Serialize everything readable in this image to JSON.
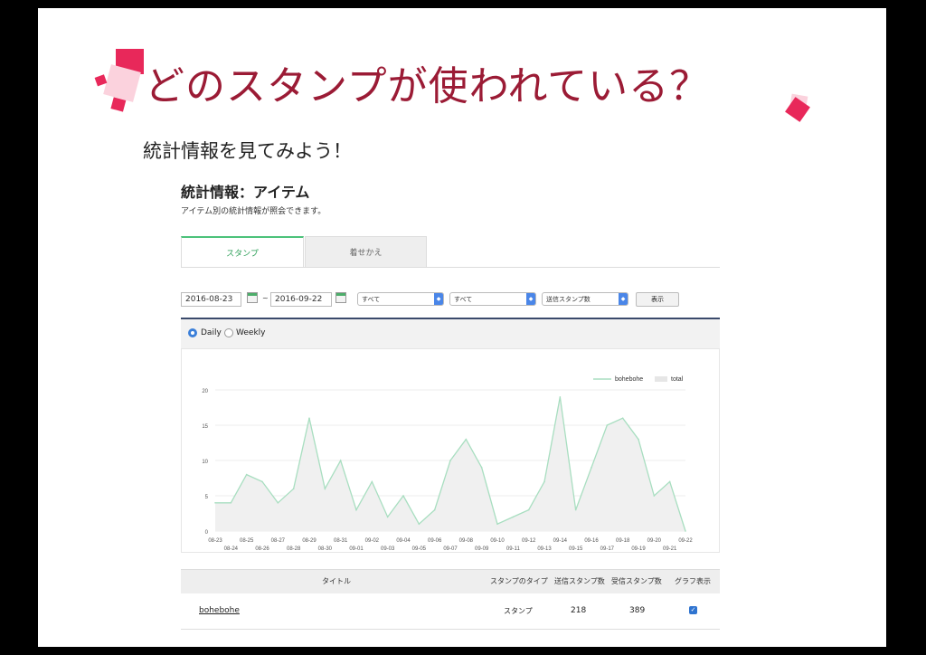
{
  "slide": {
    "title": "どのスタンプが使われている？",
    "subtitle": "統計情報を見てみよう！",
    "accent_color": "#e8285a",
    "title_color": "#9b1b35"
  },
  "screen": {
    "page_title": "統計情報：アイテム",
    "page_desc": "アイテム別の統計情報が照会できます。",
    "tabs": [
      {
        "label": "スタンプ",
        "active": true
      },
      {
        "label": "着せかえ",
        "active": false
      }
    ],
    "filters": {
      "start_date": "2016-08-23",
      "separator": "~",
      "end_date": "2016-09-22",
      "select1": "すべて",
      "select2": "すべて",
      "select3": "送信スタンプ数",
      "show_label": "表示"
    },
    "radios": [
      {
        "label": "Daily",
        "checked": true
      },
      {
        "label": "Weekly",
        "checked": false
      }
    ],
    "table": {
      "headers": [
        "タイトル",
        "スタンプのタイプ",
        "送信スタンプ数",
        "受信スタンプ数",
        "グラフ表示"
      ],
      "rows": [
        {
          "title": "bohebohe",
          "type": "スタンプ",
          "sent": "218",
          "received": "389",
          "graph": true
        }
      ]
    }
  },
  "chart_data": {
    "type": "area",
    "x": [
      "08-23",
      "08-24",
      "08-25",
      "08-26",
      "08-27",
      "08-28",
      "08-29",
      "08-30",
      "08-31",
      "09-01",
      "09-02",
      "09-03",
      "09-04",
      "09-05",
      "09-06",
      "09-07",
      "09-08",
      "09-09",
      "09-10",
      "09-11",
      "09-12",
      "09-13",
      "09-14",
      "09-15",
      "09-16",
      "09-17",
      "09-18",
      "09-19",
      "09-20",
      "09-21",
      "09-22"
    ],
    "series": [
      {
        "name": "bohebohe",
        "color": "#a8dec0",
        "values": [
          4,
          4,
          8,
          7,
          4,
          6,
          16,
          6,
          10,
          3,
          7,
          2,
          5,
          1,
          3,
          10,
          13,
          9,
          1,
          2,
          3,
          7,
          19,
          3,
          9,
          15,
          16,
          13,
          5,
          7,
          0
        ]
      },
      {
        "name": "total",
        "color": "#e6e6e6",
        "values": [
          4,
          4,
          8,
          7,
          4,
          6,
          16,
          6,
          10,
          3,
          7,
          2,
          5,
          1,
          3,
          10,
          13,
          9,
          1,
          2,
          3,
          7,
          19,
          3,
          9,
          15,
          16,
          13,
          5,
          7,
          0
        ]
      }
    ],
    "yticks": [
      0,
      5,
      10,
      15,
      20
    ],
    "ylim": [
      0,
      20
    ],
    "grid": true,
    "legend": "top-right"
  }
}
